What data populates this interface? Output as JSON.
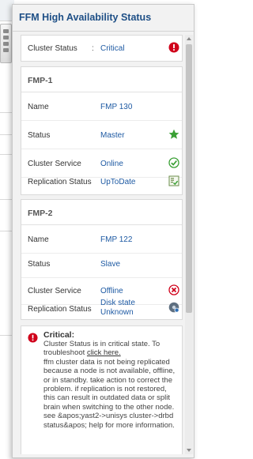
{
  "panel": {
    "title": "FFM High Availability Status"
  },
  "cluster": {
    "label": "Cluster Status",
    "separator": ":",
    "value": "Critical",
    "icon": "error-icon",
    "status_color": "#d0021b"
  },
  "fmp1": {
    "title": "FMP-1",
    "rows": [
      {
        "label": "Name",
        "value": "FMP 130"
      },
      {
        "label": "Status",
        "value": "Master",
        "icon": "star-icon"
      },
      {
        "label": "Cluster Service",
        "value": "Online",
        "icon": "check-circle-icon"
      },
      {
        "label": "Replication Status",
        "value": "UpToDate",
        "icon": "sync-ok-icon"
      }
    ]
  },
  "fmp2": {
    "title": "FMP-2",
    "rows": [
      {
        "label": "Name",
        "value": "FMP 122"
      },
      {
        "label": "Status",
        "value": "Slave"
      },
      {
        "label": "Cluster Service",
        "value": "Offline",
        "icon": "x-circle-icon"
      },
      {
        "label": "Replication Status",
        "value_line1": "Disk state",
        "value_line2": "Unknown",
        "icon": "unknown-disk-icon"
      }
    ]
  },
  "alert": {
    "title": "Critical:",
    "text_before_link": "Cluster Status is in critical state. To troubleshoot ",
    "link": "click here.",
    "text_after_link": "ffm cluster data is not being replicated because a node is not available, offline, or in standby. take action to correct the problem. if replication is not restored, this can result in outdated data or split brain when switching to the other node. see &apos;yast2->unisys cluster->drbd status&apos; help for more information."
  },
  "colors": {
    "accent": "#1e4f86",
    "value_link": "#1e5aa3",
    "ok_green": "#3aa035",
    "error_red": "#d0021b"
  }
}
